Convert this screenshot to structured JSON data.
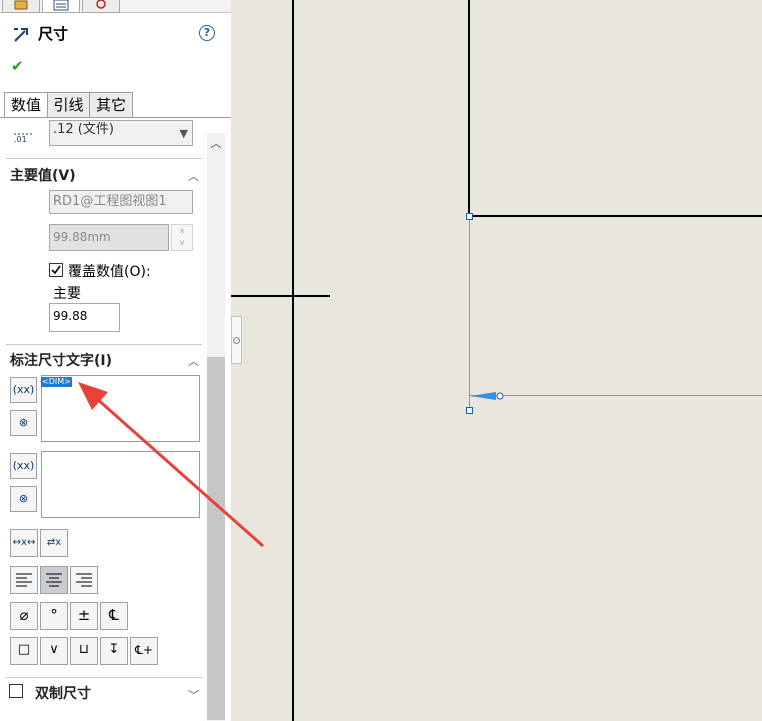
{
  "panel": {
    "title": "尺寸",
    "help_glyph": "?",
    "ok_glyph": "✔",
    "tabs": [
      "数值",
      "引线",
      "其它"
    ],
    "truncated_dropdown_value": ".12 (文件)",
    "primary_value": {
      "header": "主要值(V)",
      "reference": "RD1@工程图视图1",
      "value": "99.88mm",
      "override_checked": true,
      "override_label": "覆盖数值(O):",
      "primary_label": "主要",
      "override_value": "99.88"
    },
    "dim_text": {
      "header": "标注尺寸文字(I)",
      "insert_token": "<DIM>",
      "symbol_row1": [
        "⌀",
        "°",
        "±",
        "℄"
      ],
      "symbol_row2": [
        "□",
        "∨",
        "⊔",
        "↧",
        "℄+"
      ]
    },
    "dual_dim": {
      "label": "双制尺寸",
      "checked": false
    }
  },
  "colors": {
    "accent": "#1b7bd6",
    "annotation_arrow": "#e8413a",
    "canvas": "#e9e6dd",
    "selected_geometry": "#5ba3e6"
  }
}
